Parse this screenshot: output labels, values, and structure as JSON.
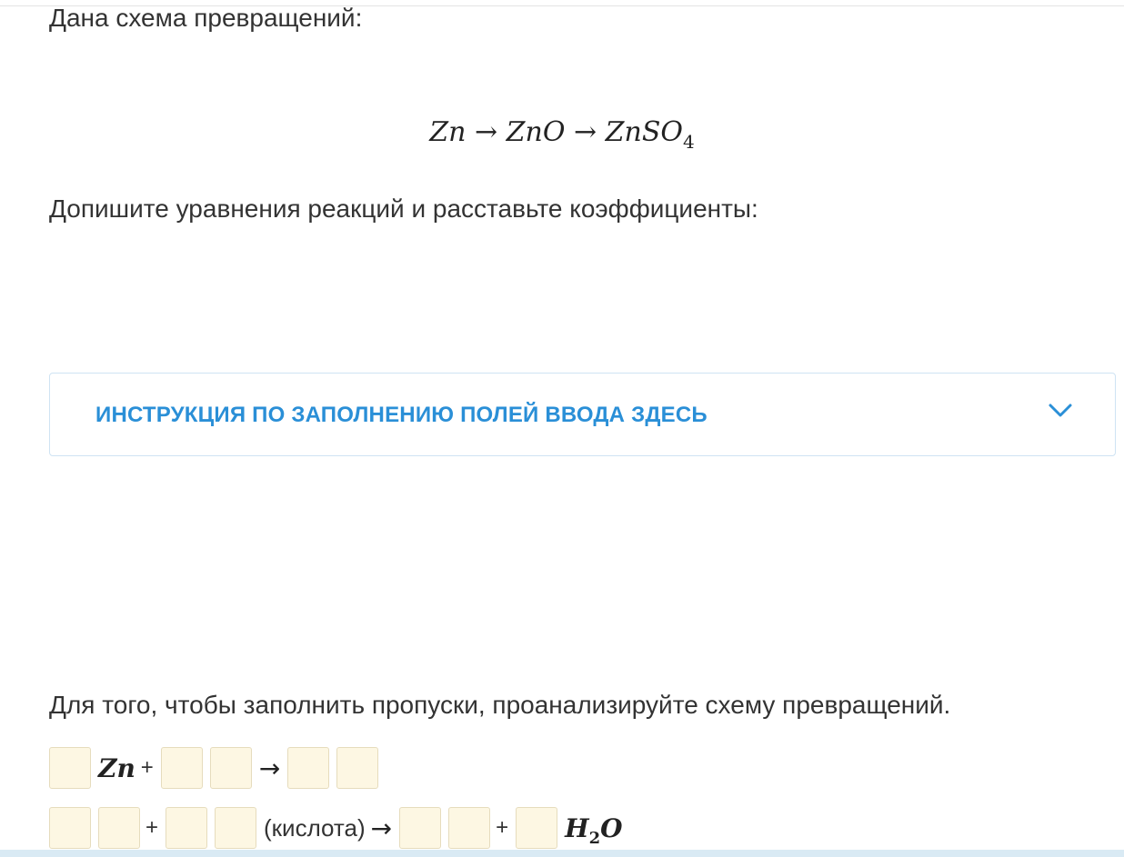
{
  "intro": "Дана схема превращений:",
  "scheme": {
    "s1": "Zn",
    "arrow": "→",
    "s2": "ZnO",
    "s3": "ZnSO",
    "s3_sub": "4"
  },
  "task": "Допишите уравнения реакций и расставьте коэффициенты:",
  "instruction": {
    "label": "ИНСТРУКЦИЯ ПО ЗАПОЛНЕНИЮ ПОЛЕЙ ВВОДА ЗДЕСЬ",
    "icon": "chevron-down-icon",
    "accent": "#2a8fd7"
  },
  "hint": "Для того, чтобы заполнить пропуски, проанализируйте схему превращений.",
  "equation1": {
    "species": "Zn",
    "plus": "+",
    "arrow": "→"
  },
  "equation2": {
    "plus1": "+",
    "note": "(кислота)",
    "arrow": "→",
    "plus2": "+",
    "water": "H",
    "water_sub": "2",
    "water_tail": "O"
  },
  "colors": {
    "input_fill": "#fdf7e3",
    "border": "#cfe3f3"
  }
}
